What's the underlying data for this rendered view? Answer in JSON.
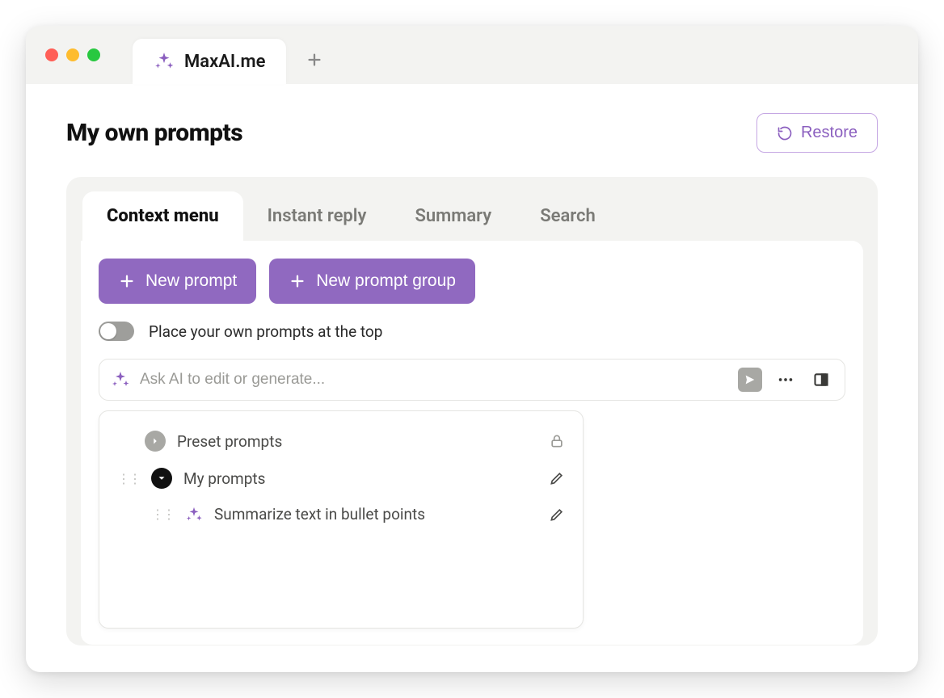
{
  "window": {
    "tab_title": "MaxAI.me"
  },
  "header": {
    "title": "My own prompts",
    "restore_label": "Restore"
  },
  "tabs": {
    "items": [
      {
        "label": "Context menu",
        "active": true
      },
      {
        "label": "Instant reply",
        "active": false
      },
      {
        "label": "Summary",
        "active": false
      },
      {
        "label": "Search",
        "active": false
      }
    ]
  },
  "toolbar": {
    "new_prompt_label": "New prompt",
    "new_group_label": "New prompt group"
  },
  "toggle": {
    "label": "Place your own prompts at the top",
    "on": false
  },
  "ask": {
    "placeholder": "Ask AI to edit or generate..."
  },
  "tree": {
    "preset_label": "Preset prompts",
    "my_label": "My prompts",
    "items": [
      {
        "label": "Summarize text in bullet points"
      }
    ]
  },
  "icons": {
    "sparkle": "sparkle-icon",
    "restore": "restore-icon",
    "plus": "plus-icon"
  },
  "colors": {
    "accent": "#8b5fbf",
    "primary_button": "#9069c0"
  }
}
